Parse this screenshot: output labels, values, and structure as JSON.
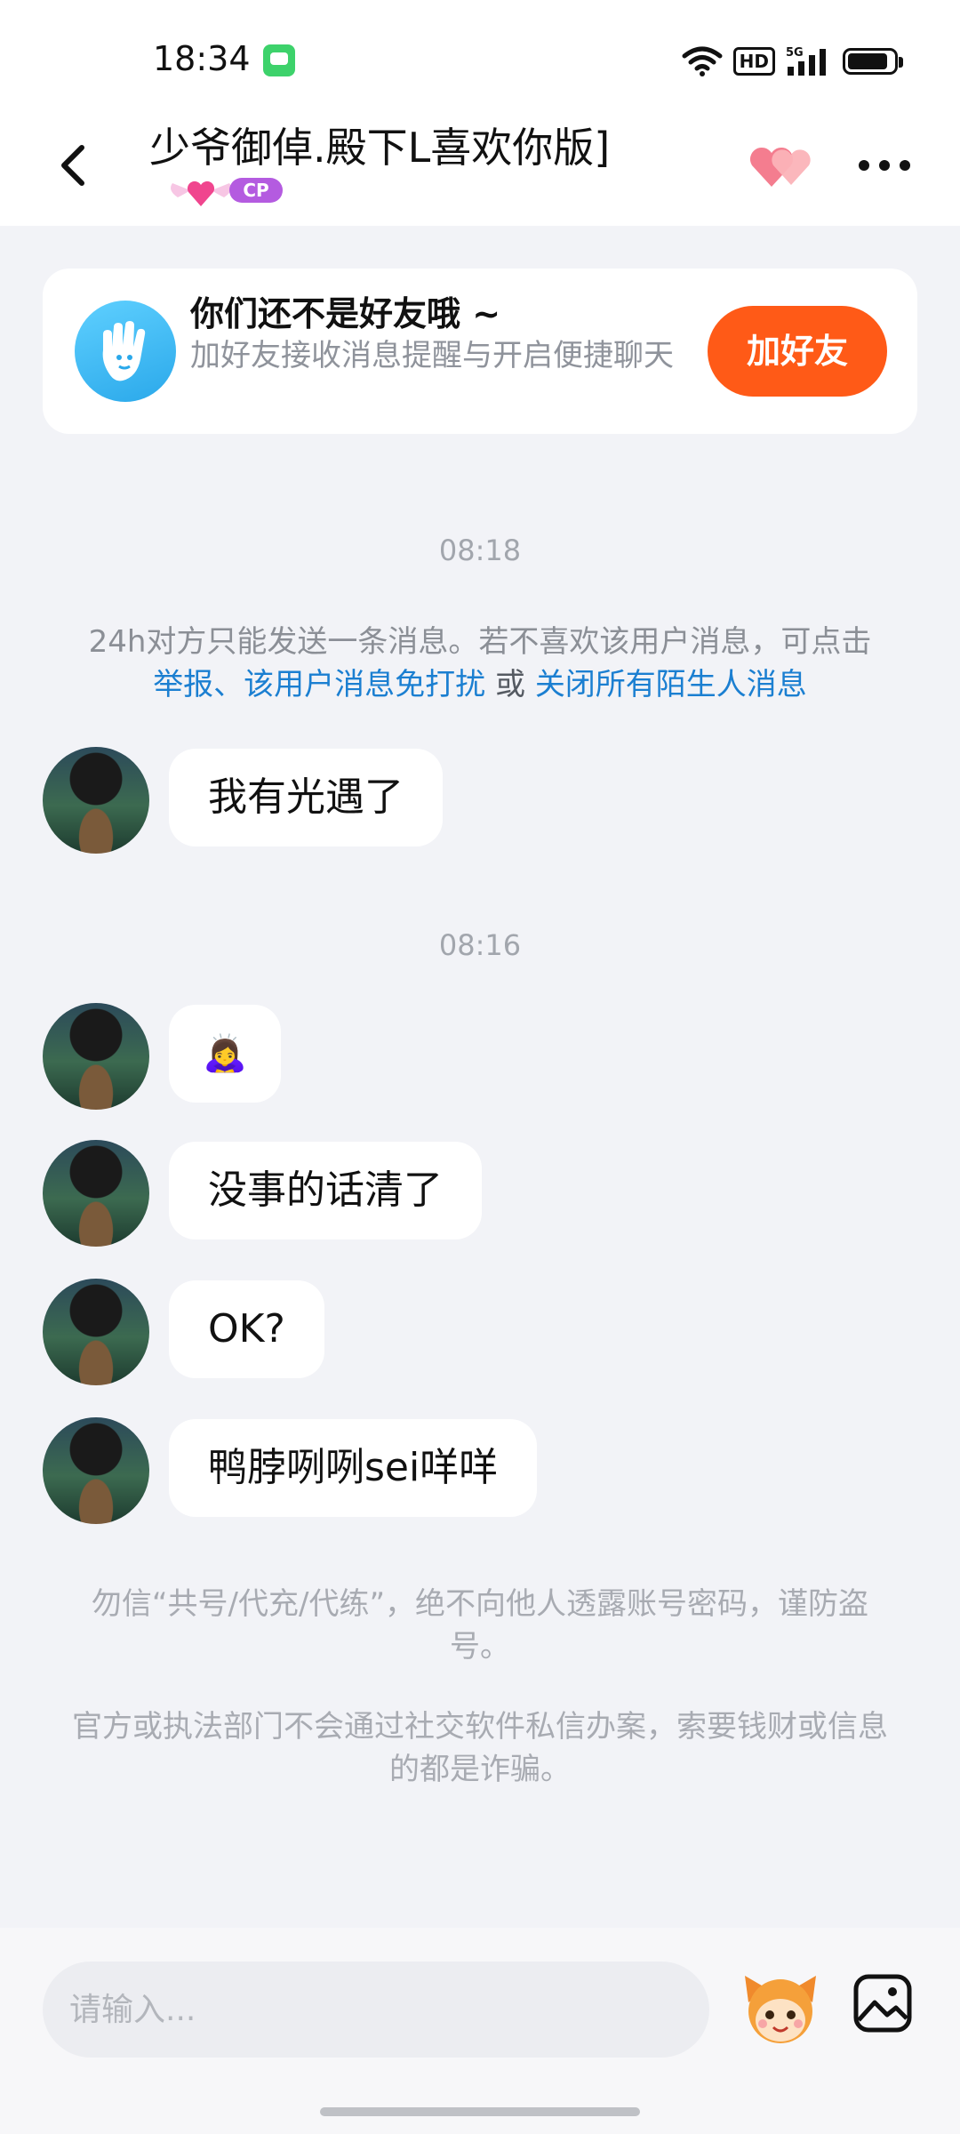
{
  "status_bar": {
    "time": "18:34",
    "hd": "HD",
    "network": "5G",
    "icons": [
      "message-app-icon",
      "wifi-icon",
      "hd-icon",
      "signal-5g-icon",
      "battery-icon"
    ]
  },
  "header": {
    "title": "少爷御倬.殿下L喜欢你版]",
    "badge": "CP",
    "icons": [
      "back-arrow-icon",
      "hearts-icon",
      "more-dots-icon"
    ]
  },
  "friend_banner": {
    "title": "你们还不是好友哦 ~",
    "subtitle": "加好友接收消息提醒与开启便捷聊天",
    "button": "加好友"
  },
  "messages_section": {
    "timestamp_1": "08:18",
    "notice_text": "24h对方只能发送一条消息。若不喜欢该用户消息，可点击",
    "notice_link_1": "举报、该用户消息免打扰",
    "notice_or": " 或 ",
    "notice_link_2": "关闭所有陌生人消息",
    "msg_1": "我有光遇了",
    "timestamp_2": "08:16",
    "msg_2_emoji": "🙇‍♀️",
    "msg_3": "没事的话清了",
    "msg_4": "OK?",
    "msg_5": "鸭脖咧咧sei咩咩"
  },
  "warnings": {
    "warning_1": "勿信“共号/代充/代练”，绝不向他人透露账号密码，谨防盗号。",
    "warning_2": "官方或执法部门不会通过社交软件私信办案，索要钱财或信息的都是诈骗。"
  },
  "input_bar": {
    "placeholder": "请输入...",
    "icons": [
      "mascot-emoji-icon",
      "image-icon"
    ]
  },
  "colors": {
    "accent_orange": "#ff5a17",
    "link_blue": "#1b7fd1",
    "cp_purple": "#b45be0",
    "background": "#f2f3f7"
  }
}
